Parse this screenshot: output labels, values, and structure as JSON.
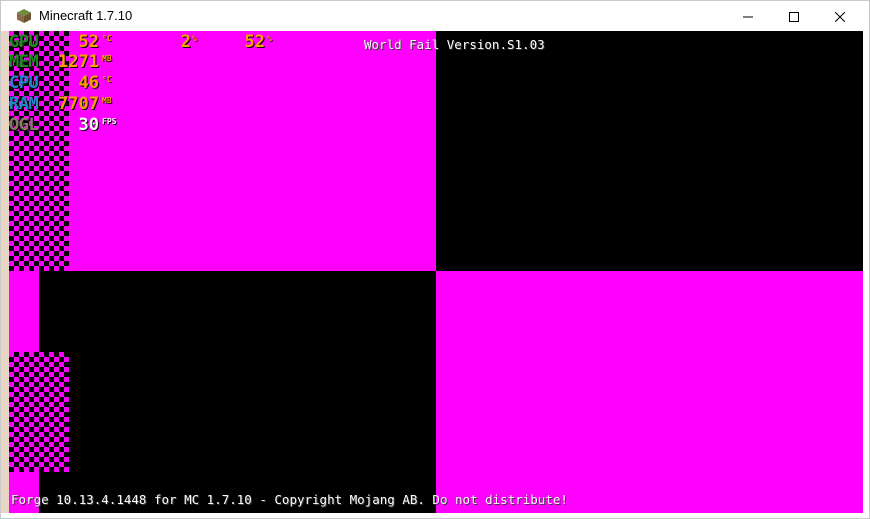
{
  "window": {
    "title": "Minecraft 1.7.10",
    "icons": {
      "app": "minecraft-grass-block-icon",
      "minimize": "minimize-icon",
      "maximize": "maximize-icon",
      "close": "close-icon"
    }
  },
  "hud": {
    "gpu": {
      "label": "GPU",
      "temp": "52",
      "temp_unit": "°C",
      "usage": "2",
      "usage_unit": "%",
      "fan": "52",
      "fan_unit": "%"
    },
    "mem": {
      "label": "MEM",
      "value": "1271",
      "unit": "MB"
    },
    "cpu": {
      "label": "CPU",
      "value": "46",
      "unit": "°C"
    },
    "ram": {
      "label": "RAM",
      "value": "7707",
      "unit": "MB"
    },
    "ogl": {
      "label": "OGL",
      "value": "30",
      "unit": "FPS"
    }
  },
  "version_text": "World Fail Version.S1.03",
  "footer_text": "Forge 10.13.4.1448 for MC 1.7.10 - Copyright Mojang AB. Do not distribute!",
  "colors": {
    "missing_texture_magenta": "#ff00ff",
    "black": "#000000"
  }
}
